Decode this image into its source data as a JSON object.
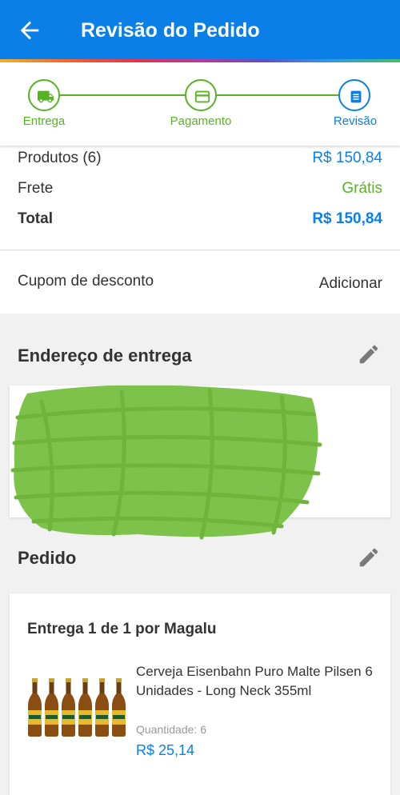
{
  "app_bar": {
    "title": "Revisão do Pedido",
    "back_icon": "arrow-left-icon"
  },
  "steps": [
    {
      "label": "Entrega",
      "icon": "truck-icon",
      "state": "done"
    },
    {
      "label": "Pagamento",
      "icon": "credit-card-icon",
      "state": "done"
    },
    {
      "label": "Revisão",
      "icon": "list-icon",
      "state": "current"
    }
  ],
  "summary": {
    "products_label": "Produtos (6)",
    "products_value": "R$ 150,84",
    "shipping_label": "Frete",
    "shipping_value": "Grátis",
    "total_label": "Total",
    "total_value": "R$ 150,84"
  },
  "coupon": {
    "label": "Cupom de desconto",
    "action": "Adicionar"
  },
  "address": {
    "title": "Endereço de entrega",
    "edit_icon": "pencil-icon"
  },
  "order": {
    "title": "Pedido",
    "edit_icon": "pencil-icon",
    "delivery_title": "Entrega 1 de 1 por Magalu",
    "item": {
      "name": "Cerveja Eisenbahn Puro Malte Pilsen 6 Unidades - Long Neck 355ml",
      "quantity_label": "Quantidade:",
      "quantity": "6",
      "price": "R$ 25,14"
    }
  },
  "colors": {
    "primary": "#0a7fe8",
    "success": "#58b324",
    "text": "#333333"
  }
}
